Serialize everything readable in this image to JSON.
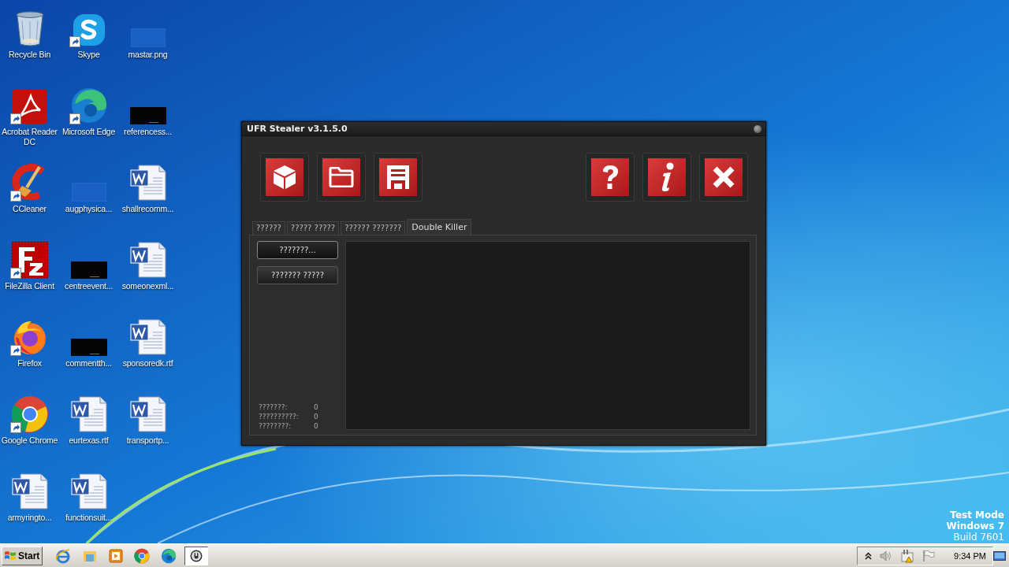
{
  "desktop": {
    "icons": [
      {
        "label": "Recycle Bin",
        "kind": "recycle",
        "shortcut": false
      },
      {
        "label": "Acrobat Reader DC",
        "kind": "acrobat",
        "shortcut": true
      },
      {
        "label": "CCleaner",
        "kind": "ccleaner",
        "shortcut": true
      },
      {
        "label": "FileZilla Client",
        "kind": "filezilla",
        "shortcut": true
      },
      {
        "label": "Firefox",
        "kind": "firefox",
        "shortcut": true
      },
      {
        "label": "Google Chrome",
        "kind": "chrome",
        "shortcut": true
      },
      {
        "label": "armyringto...",
        "kind": "word",
        "shortcut": false
      },
      {
        "label": "Skype",
        "kind": "skype",
        "shortcut": true
      },
      {
        "label": "Microsoft Edge",
        "kind": "edge",
        "shortcut": true
      },
      {
        "label": "augphysica...",
        "kind": "blank",
        "shortcut": false
      },
      {
        "label": "centreevent...",
        "kind": "dark",
        "shortcut": false
      },
      {
        "label": "commentth...",
        "kind": "dark",
        "shortcut": false
      },
      {
        "label": "eurtexas.rtf",
        "kind": "word",
        "shortcut": false
      },
      {
        "label": "functionsuit...",
        "kind": "word",
        "shortcut": false
      },
      {
        "label": "mastar.png",
        "kind": "blank",
        "shortcut": false
      },
      {
        "label": "referencess...",
        "kind": "dark",
        "shortcut": false
      },
      {
        "label": "shallrecomm...",
        "kind": "word",
        "shortcut": false
      },
      {
        "label": "someonexml...",
        "kind": "word",
        "shortcut": false
      },
      {
        "label": "sponsoredk.rtf",
        "kind": "word",
        "shortcut": false
      },
      {
        "label": "transportp...",
        "kind": "word",
        "shortcut": false
      }
    ]
  },
  "window": {
    "title": "UFR Stealer v3.1.5.0",
    "toolbar_left": [
      {
        "kind": "cube"
      },
      {
        "kind": "folder"
      },
      {
        "kind": "save"
      }
    ],
    "toolbar_right": [
      {
        "kind": "help"
      },
      {
        "kind": "info"
      },
      {
        "kind": "close"
      }
    ],
    "tabs": [
      {
        "label": "??????",
        "selected": false
      },
      {
        "label": "????? ?????",
        "selected": false
      },
      {
        "label": "?????? ???????",
        "selected": false
      },
      {
        "label": "Double Killer",
        "selected": true
      }
    ],
    "actions": [
      "???????...",
      "??????? ?????"
    ],
    "stats": [
      {
        "label": "???????:",
        "value": "0"
      },
      {
        "label": "??????????:",
        "value": "0"
      },
      {
        "label": "????????:",
        "value": "0"
      }
    ]
  },
  "os_notice": [
    "Test Mode",
    "Windows 7",
    "Build 7601"
  ],
  "taskbar": {
    "start": "Start",
    "pinned": [
      {
        "kind": "ie"
      },
      {
        "kind": "explorer"
      },
      {
        "kind": "media"
      },
      {
        "kind": "chrome"
      },
      {
        "kind": "edge"
      }
    ],
    "tasks": [
      {
        "kind": "app",
        "selected": true
      }
    ],
    "tray": [
      {
        "kind": "chevron"
      },
      {
        "kind": "speaker"
      },
      {
        "kind": "network"
      },
      {
        "kind": "flag"
      }
    ],
    "clock": "9:34 PM"
  }
}
